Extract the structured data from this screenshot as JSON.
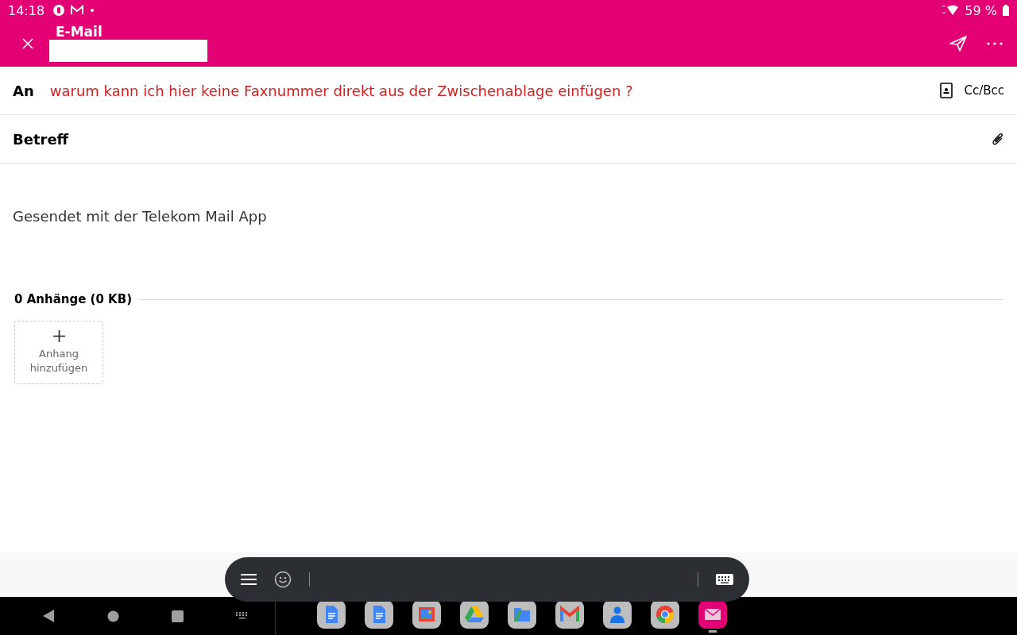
{
  "status_bar": {
    "time": "14:18",
    "battery": "59 %"
  },
  "toolbar": {
    "title": "E-Mail"
  },
  "compose": {
    "to_label": "An",
    "to_value": "warum kann ich hier keine Faxnummer direkt aus der Zwischenablage einfügen ?",
    "to_invalid": true,
    "cc_bcc": "Cc/Bcc",
    "subject_label": "Betreff",
    "body": "Gesendet mit der Telekom Mail App"
  },
  "attachments": {
    "heading": "0 Anhänge (0 KB)",
    "add_label": "Anhang hinzufügen"
  },
  "dock": [
    {
      "kind": "docs",
      "active": false
    },
    {
      "kind": "docs",
      "active": false
    },
    {
      "kind": "gallery",
      "active": false
    },
    {
      "kind": "drive",
      "active": false
    },
    {
      "kind": "files",
      "active": false
    },
    {
      "kind": "gmail",
      "active": false
    },
    {
      "kind": "contacts",
      "active": false
    },
    {
      "kind": "chrome",
      "active": false
    },
    {
      "kind": "mail",
      "active": true
    }
  ]
}
